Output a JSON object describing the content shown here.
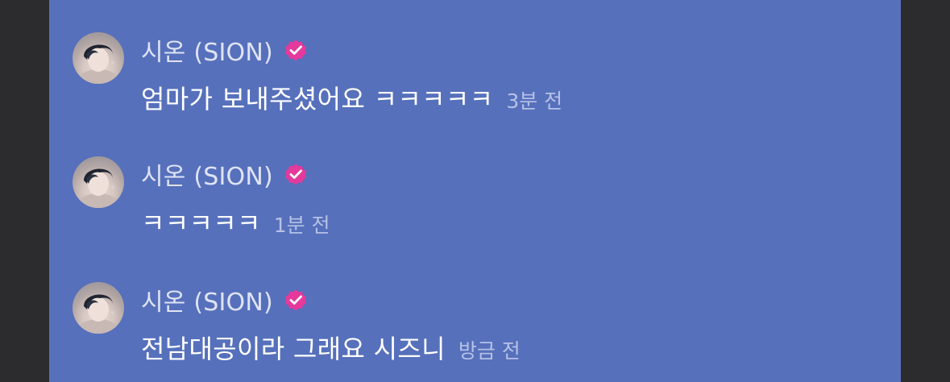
{
  "colors": {
    "panel_bg": "#5670bb",
    "side_bg": "#2c2c2e",
    "name_text": "#dfe3f4",
    "message_text": "#ffffff",
    "time_text": "#b6c1e6",
    "verified_badge": "#e5399b"
  },
  "messages": [
    {
      "author": "시온 (SION)",
      "verified_icon": "verified-badge-icon",
      "text": "엄마가 보내주셨어요 ㅋㅋㅋㅋㅋ",
      "time": "3분 전"
    },
    {
      "author": "시온 (SION)",
      "verified_icon": "verified-badge-icon",
      "text": "ㅋㅋㅋㅋㅋ",
      "time": "1분 전"
    },
    {
      "author": "시온 (SION)",
      "verified_icon": "verified-badge-icon",
      "text": "전남대공이라 그래요 시즈니",
      "time": "방금 전"
    }
  ]
}
